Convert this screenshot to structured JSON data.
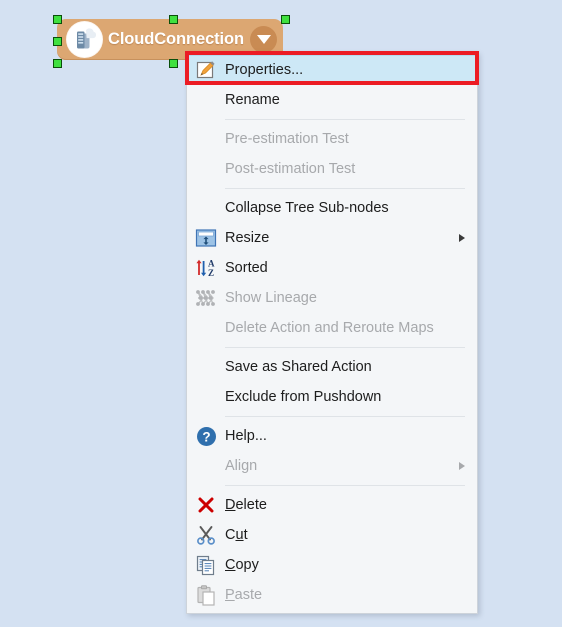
{
  "canvas": {
    "background_color": "#d4e1f2",
    "node": {
      "label": "CloudConnection",
      "fill_color": "#dca772",
      "text_color": "#ffffff",
      "icon_name": "cloud-connection-icon",
      "dropdown_icon": "chevron-down-icon",
      "selected": true,
      "handle_color": "#3fe03f",
      "handle_count": 6
    }
  },
  "annotation": {
    "type": "rectangle-highlight",
    "color": "#ec1c24",
    "target": "Properties..."
  },
  "context_menu": {
    "highlighted_item": "Properties...",
    "highlight_color": "#cde8f6",
    "items": [
      {
        "label": "Properties...",
        "icon": "edit-properties-icon",
        "disabled": false,
        "highlighted": true,
        "submenu": false,
        "separator_after": false
      },
      {
        "label": "Rename",
        "icon": "none",
        "disabled": false,
        "highlighted": false,
        "submenu": false,
        "separator_after": true
      },
      {
        "label": "Pre-estimation Test",
        "icon": "none",
        "disabled": true,
        "highlighted": false,
        "submenu": false,
        "separator_after": false
      },
      {
        "label": "Post-estimation Test",
        "icon": "none",
        "disabled": true,
        "highlighted": false,
        "submenu": false,
        "separator_after": true
      },
      {
        "label": "Collapse Tree Sub-nodes",
        "icon": "none",
        "disabled": false,
        "highlighted": false,
        "submenu": false,
        "separator_after": false
      },
      {
        "label": "Resize",
        "icon": "resize-icon",
        "disabled": false,
        "highlighted": false,
        "submenu": true,
        "separator_after": false
      },
      {
        "label": "Sorted",
        "icon": "sort-az-icon",
        "disabled": false,
        "highlighted": false,
        "submenu": false,
        "separator_after": false
      },
      {
        "label": "Show Lineage",
        "icon": "lineage-icon",
        "disabled": true,
        "highlighted": false,
        "submenu": false,
        "separator_after": false
      },
      {
        "label": "Delete Action and Reroute Maps",
        "icon": "none",
        "disabled": true,
        "highlighted": false,
        "submenu": false,
        "separator_after": true
      },
      {
        "label": "Save as Shared Action",
        "icon": "none",
        "disabled": false,
        "highlighted": false,
        "submenu": false,
        "separator_after": false
      },
      {
        "label": "Exclude from Pushdown",
        "icon": "none",
        "disabled": false,
        "highlighted": false,
        "submenu": false,
        "separator_after": true
      },
      {
        "label": "Help...",
        "icon": "help-icon",
        "disabled": false,
        "highlighted": false,
        "submenu": false,
        "separator_after": false
      },
      {
        "label": "Align",
        "icon": "none",
        "disabled": true,
        "highlighted": false,
        "submenu": true,
        "separator_after": true
      },
      {
        "label": "Delete",
        "icon": "delete-x-icon",
        "disabled": false,
        "highlighted": false,
        "submenu": false,
        "separator_after": false,
        "accelerator": "D"
      },
      {
        "label": "Cut",
        "icon": "scissors-icon",
        "disabled": false,
        "highlighted": false,
        "submenu": false,
        "separator_after": false,
        "accelerator": "u"
      },
      {
        "label": "Copy",
        "icon": "copy-icon",
        "disabled": false,
        "highlighted": false,
        "submenu": false,
        "separator_after": false,
        "accelerator": "C"
      },
      {
        "label": "Paste",
        "icon": "paste-icon",
        "disabled": true,
        "highlighted": false,
        "submenu": false,
        "separator_after": false,
        "accelerator": "P"
      }
    ]
  }
}
